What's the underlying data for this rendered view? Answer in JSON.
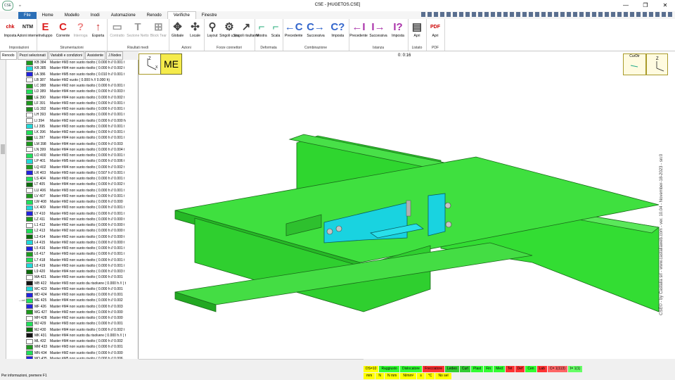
{
  "window": {
    "title": "CSE - [HUGETOS.CSE]",
    "qat": "▫"
  },
  "ribbon_tabs": [
    "Home",
    "Modello",
    "Inodi",
    "Automazione",
    "Renodo",
    "Verifiche",
    "Finestre"
  ],
  "file_tab": "File",
  "active_tab": "Verifiche",
  "groups": [
    {
      "label": "Impostazioni",
      "buttons": [
        {
          "icon": "chk",
          "label": "Imposta",
          "color": "#c00"
        },
        {
          "icon": "NTM",
          "label": "Azioni interne",
          "color": "#222"
        }
      ]
    },
    {
      "label": "Strumentazioni",
      "buttons": [
        {
          "icon": "E",
          "label": "Inviluppo",
          "color": "#d22"
        },
        {
          "icon": "C",
          "label": "Corrente",
          "color": "#d22"
        },
        {
          "icon": "?",
          "label": "Interroga",
          "color": "#e88",
          "dis": true
        },
        {
          "icon": "↑",
          "label": "Esporta",
          "color": "#c33"
        }
      ]
    },
    {
      "label": "Risultati medi",
      "buttons": [
        {
          "icon": "▭",
          "label": "Contratto",
          "color": "#999",
          "dis": true
        },
        {
          "icon": "T",
          "label": "Sezione Netto",
          "color": "#999",
          "dis": true
        },
        {
          "icon": "⊞",
          "label": "Block Tear",
          "color": "#999",
          "dis": true
        }
      ]
    },
    {
      "label": "Azioni",
      "buttons": [
        {
          "icon": "✥",
          "label": "Globale",
          "color": "#444"
        },
        {
          "icon": "✣",
          "label": "Locale",
          "color": "#444"
        }
      ]
    },
    {
      "label": "Forze connettori",
      "buttons": [
        {
          "icon": "⚲",
          "label": "Layout",
          "color": "#444"
        },
        {
          "icon": "⚙",
          "label": "Singoli u,v,w",
          "color": "#444"
        },
        {
          "icon": "↗",
          "label": "Singoli risultante",
          "color": "#444"
        }
      ]
    },
    {
      "label": "Deformata",
      "buttons": [
        {
          "icon": "⌐",
          "label": "Mostra",
          "color": "#2a7"
        },
        {
          "icon": "⌐",
          "label": "Scala",
          "color": "#2a7"
        }
      ]
    },
    {
      "label": "Combinazione",
      "buttons": [
        {
          "icon": "←C",
          "label": "Precedente",
          "color": "#36c"
        },
        {
          "icon": "C→",
          "label": "Successiva",
          "color": "#36c"
        },
        {
          "icon": "C?",
          "label": "Imposta",
          "color": "#36c"
        }
      ]
    },
    {
      "label": "Istanza",
      "buttons": [
        {
          "icon": "←I",
          "label": "Precedente",
          "color": "#a3a"
        },
        {
          "icon": "I→",
          "label": "Successiva",
          "color": "#a3a"
        },
        {
          "icon": "I?",
          "label": "Imposta",
          "color": "#a3a"
        }
      ]
    },
    {
      "label": "Listato",
      "buttons": [
        {
          "icon": "▤",
          "label": "Apri",
          "color": "#444"
        }
      ]
    },
    {
      "label": "PDF",
      "buttons": [
        {
          "icon": "PDF",
          "label": "Apri",
          "color": "#c00"
        }
      ]
    }
  ],
  "panel_tabs": [
    "Renodo",
    "Pezzi selezionati",
    "Variabili e condizioni",
    "Assistente",
    "J.Nodex"
  ],
  "rows": [
    {
      "id": "KB 384",
      "text": "Master  #M3 non vuoto risolto ( 0.000 h  //  0.001 t",
      "c": "#1d9a1d"
    },
    {
      "id": "KB 385",
      "text": "Master  #M4 non vuoto risolto ( 0.000 h  //  0.002 t",
      "c": "#1fd9d9"
    },
    {
      "id": "LA 386",
      "text": "Master  #M5 non vuoto risolto ( 0.010 h  //  0.001 t",
      "c": "#2222dd"
    },
    {
      "id": "LB 387",
      "text": "Master  #M2 vuoto ( 0.000 h  //  0.000 h)",
      "c": "#ffffff"
    },
    {
      "id": "LC 388",
      "text": "Master  #M2 non vuoto risolto ( 0.000 h  //  0.001 t",
      "c": "#1d9a1d"
    },
    {
      "id": "LD 389",
      "text": "Master  #M4 non vuoto risolto ( 0.000 h  //  0.003 t",
      "c": "#1fe05a"
    },
    {
      "id": "LE 390",
      "text": "Master  #M4 non vuoto risolto ( 0.000 h  //  0.002 t",
      "c": "#0b6b0b"
    },
    {
      "id": "LF 391",
      "text": "Master  #M3 non vuoto risolto ( 0.000 h  //  0.001 t",
      "c": "#1d9a1d"
    },
    {
      "id": "LG 392",
      "text": "Master  #M3 non vuoto risolto ( 0.000 h  //  0.001 t",
      "c": "#1d8a1d"
    },
    {
      "id": "LH 393",
      "text": "Master  #M3 non vuoto risolto ( 0.000 h  //  0.001 t",
      "c": "#ffffff"
    },
    {
      "id": "LI 394",
      "text": "Master  #M2 non vuoto risolto ( 0.000 h  //  0.000 h",
      "c": "#ffffff"
    },
    {
      "id": "LJ 395",
      "text": "Master  #M3 non vuoto risolto ( 0.000 h  //  0.001 t",
      "c": "#1fd9d9"
    },
    {
      "id": "LK 396",
      "text": "Master  #M2 non vuoto risolto ( 0.000 h  //  0.001 t",
      "c": "#1fe05a"
    },
    {
      "id": "LL 397",
      "text": "Master  #M4 non vuoto risolto ( 0.000 h  //  0.001 t",
      "c": "#0b6b0b"
    },
    {
      "id": "LM 398",
      "text": "Master  #M4 non vuoto risolto ( 0.000 h  //  0.003",
      "c": "#1d9a1d"
    },
    {
      "id": "LN 399",
      "text": "Master  #M4 non vuoto risolto ( 0.000 h  //  0.004 t",
      "c": "#ffffff"
    },
    {
      "id": "LO 400",
      "text": "Master  #M3 non vuoto risolto ( 0.000 h  //  0.001 t",
      "c": "#1fe05a"
    },
    {
      "id": "LP 401",
      "text": "Master  #M5 non vuoto risolto ( 0.000 h  //  0.006 t",
      "c": "#1fd9d9"
    },
    {
      "id": "LQ 402",
      "text": "Master  #M4 non vuoto risolto ( 0.000 h  //  0.002 t",
      "c": "#1d9a1d"
    },
    {
      "id": "LR 403",
      "text": "Master  #M3 non vuoto risolto ( 0.507 h  //  0.001 t",
      "c": "#2222dd"
    },
    {
      "id": "LS 404",
      "text": "Master  #M3 non vuoto risolto ( 0.000 h  //  0.001 t",
      "c": "#1fe05a"
    },
    {
      "id": "LT 405",
      "text": "Master  #M4 non vuoto risolto ( 0.000 h  //  0.002 t",
      "c": "#0b6b0b"
    },
    {
      "id": "LU 406",
      "text": "Master  #M3 non vuoto risolto ( 0.000 h  //  0.001 t",
      "c": "#ffffff"
    },
    {
      "id": "LV 407",
      "text": "Master  #M3 non vuoto risolto ( 0.000 h  //  0.001 t",
      "c": "#1d9a1d"
    },
    {
      "id": "LW 408",
      "text": "Master  #M2 non vuoto risolto ( 0.000 h  //  0.000",
      "c": "#1fe05a"
    },
    {
      "id": "LX 409",
      "text": "Master  #M3 non vuoto risolto ( 0.000 h  //  0.001 t",
      "c": "#1fd9d9"
    },
    {
      "id": "LY 410",
      "text": "Master  #M3 non vuoto risolto ( 0.000 h  //  0.001 t",
      "c": "#2222dd"
    },
    {
      "id": "LZ 411",
      "text": "Master  #M2 non vuoto risolto ( 0.000 h  //  0.000 t",
      "c": "#1d9a1d"
    },
    {
      "id": "L1 412",
      "text": "Master  #M2 non vuoto risolto ( 0.000 h  //  0.000 t",
      "c": "#ffffff"
    },
    {
      "id": "L2 413",
      "text": "Master  #M2 non vuoto risolto ( 0.000 h  //  0.000 t",
      "c": "#1fe05a"
    },
    {
      "id": "L3 414",
      "text": "Master  #M2 non vuoto risolto ( 0.000 h  //  0.000 t",
      "c": "#0b6b0b"
    },
    {
      "id": "L4 415",
      "text": "Master  #M2 non vuoto risolto ( 0.000 h  //  0.000 t",
      "c": "#1fd9d9"
    },
    {
      "id": "L5 416",
      "text": "Master  #M3 non vuoto risolto ( 0.000 h  //  0.001 t",
      "c": "#2222dd"
    },
    {
      "id": "L6 417",
      "text": "Master  #M3 non vuoto risolto ( 0.000 h  //  0.001 t",
      "c": "#1d9a1d"
    },
    {
      "id": "L7 418",
      "text": "Master  #M3 non vuoto risolto ( 0.000 h  //  0.001 t",
      "c": "#1fe05a"
    },
    {
      "id": "L8 419",
      "text": "Master  #M3 non vuoto risolto ( 0.000 h  //  0.001 t",
      "c": "#1fd9d9"
    },
    {
      "id": "L9 420",
      "text": "Master  #M4 non vuoto risolto ( 0.000 h  //  0.003 t",
      "c": "#0b6b0b"
    },
    {
      "id": "MA 421",
      "text": "Master  #M3 non vuoto risolto ( 0.000 h  //  0.001",
      "c": "#ffffff"
    },
    {
      "id": "MB 422",
      "text": "Master  #M3 non vuoto da risolvere ( 0.000 h  //  ( t",
      "c": "#111111"
    },
    {
      "id": "MC 423",
      "text": "Master  #M3 non vuoto risolto ( 0.000 h  //  0.001",
      "c": "#1fd9d9"
    },
    {
      "id": "MD 424",
      "text": "Master  #M3 non vuoto risolto ( 0.000 h  //  0.001",
      "c": "#2222dd"
    },
    {
      "id": "ME 425",
      "text": "Master  #M4 non vuoto risolto ( 0.000 h  //  0.002",
      "c": "#1fe05a",
      "mark": "—sel"
    },
    {
      "id": "MF 426",
      "text": "Master  #M4 non vuoto risolto ( 0.000 h  //  0.003",
      "c": "#2222dd"
    },
    {
      "id": "MG 427",
      "text": "Master  #M2 non vuoto risolto ( 0.000 h  //  0.000",
      "c": "#1d9a1d"
    },
    {
      "id": "MH 428",
      "text": "Master  #M2 non vuoto risolto ( 0.000 h  //  0.000",
      "c": "#ffffff"
    },
    {
      "id": "MJ 429",
      "text": "Master  #M3 non vuoto risolto ( 0.000 h  //  0.001",
      "c": "#1fe05a"
    },
    {
      "id": "MJ 430",
      "text": "Master  #M4 non vuoto risolto ( 0.000 h  //  0.002 t",
      "c": "#0b6b0b"
    },
    {
      "id": "MK 431",
      "text": "Master  #M4 non vuoto da risolvere ( 0.000 h  //  ( t",
      "c": "#111111"
    },
    {
      "id": "ML 432",
      "text": "Master  #M4 non vuoto risolto ( 0.000 h  //  0.002",
      "c": "#ffffff"
    },
    {
      "id": "MM 433",
      "text": "Master  #M3 non vuoto risolto ( 0.000 h  //  0.001",
      "c": "#1d9a1d"
    },
    {
      "id": "MN 434",
      "text": "Master  #M2 non vuoto risolto ( 0.000 h  //  0.000",
      "c": "#1fe05a"
    },
    {
      "id": "MO 435",
      "text": "Master  #M5 non vuoto risolto ( 0.000 h  //  0.006",
      "c": "#2222dd"
    },
    {
      "id": "MP 436",
      "text": "Master  #M3 non vuoto risolto ( 0.000 h  //  0.001",
      "c": "#1fd9d9"
    }
  ],
  "viewport": {
    "badge": "ME",
    "timer": "0: 0:16",
    "cordir_label": "CurDir",
    "axis_z": "Z",
    "axis_x": "X",
    "watermark": "CSE© - by Castalia srl - www.castaliaweb.com - ver. 10.04 - November-18-2023 - sn:0"
  },
  "status_row1": [
    {
      "t": "DS=10",
      "c": "#ffff00"
    },
    {
      "t": "Raggiusto",
      "c": "#33ff33"
    },
    {
      "t": "Dislocatore",
      "c": "#33ff33"
    },
    {
      "t": "Frecciatore",
      "c": "#ff3333"
    },
    {
      "t": "Ledeo",
      "c": "#33cc33"
    },
    {
      "t": "Curl",
      "c": "#33cc33"
    },
    {
      "t": "Plast",
      "c": "#33ff33"
    },
    {
      "t": "Fin",
      "c": "#33ff33"
    },
    {
      "t": "Med",
      "c": "#33ff33"
    },
    {
      "t": "Tet",
      "c": "#ff3333"
    },
    {
      "t": "Def",
      "c": "#ff3333"
    },
    {
      "t": "Cen",
      "c": "#33ff33"
    },
    {
      "t": "Lab",
      "c": "#ff3333"
    },
    {
      "t": "C= 1(113)",
      "c": "#ff6666"
    },
    {
      "t": "I= 1(1)",
      "c": "#66ff66"
    }
  ],
  "status_row2": [
    "mm",
    "N",
    "N mm",
    "N/mm²",
    "s",
    "°C",
    "No sel"
  ],
  "status_info": "Per informazioni, premere F1"
}
